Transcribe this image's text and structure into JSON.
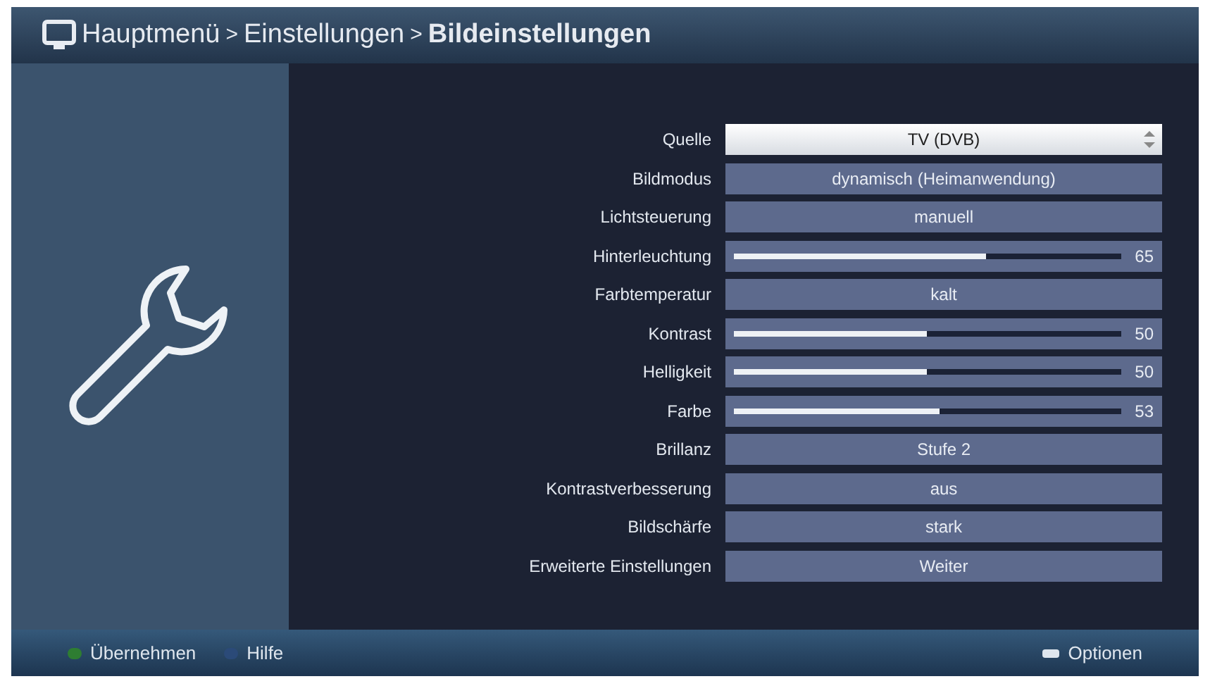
{
  "title_bar": {
    "breadcrumb": [
      "Hauptmenü",
      "Einstellungen",
      "Bildeinstellungen"
    ],
    "separator": ">"
  },
  "settings": [
    {
      "kind": "choice",
      "label": "Quelle",
      "value": "TV (DVB)",
      "selected": true
    },
    {
      "kind": "choice",
      "label": "Bildmodus",
      "value": "dynamisch (Heimanwendung)",
      "selected": false
    },
    {
      "kind": "choice",
      "label": "Lichtsteuerung",
      "value": "manuell",
      "selected": false
    },
    {
      "kind": "slider",
      "label": "Hinterleuchtung",
      "level": 0.65,
      "reading": "65",
      "selected": false
    },
    {
      "kind": "choice",
      "label": "Farbtemperatur",
      "value": "kalt",
      "selected": false
    },
    {
      "kind": "slider",
      "label": "Kontrast",
      "level": 0.5,
      "reading": "50",
      "selected": false
    },
    {
      "kind": "slider",
      "label": "Helligkeit",
      "level": 0.5,
      "reading": "50",
      "selected": false
    },
    {
      "kind": "slider",
      "label": "Farbe",
      "level": 0.53,
      "reading": "53",
      "selected": false
    },
    {
      "kind": "choice",
      "label": "Brillanz",
      "value": "Stufe 2",
      "selected": false
    },
    {
      "kind": "choice",
      "label": "Kontrastverbesserung",
      "value": "aus",
      "selected": false
    },
    {
      "kind": "choice",
      "label": "Bildschärfe",
      "value": "stark",
      "selected": false
    },
    {
      "kind": "choice",
      "label": "Erweiterte Einstellungen",
      "value": "Weiter",
      "selected": false
    }
  ],
  "footer": {
    "left": [
      {
        "label": "Übernehmen",
        "color": "#2e7d32"
      },
      {
        "label": "Hilfe",
        "color": "#2b4a78"
      }
    ],
    "right": {
      "label": "Optionen"
    }
  }
}
